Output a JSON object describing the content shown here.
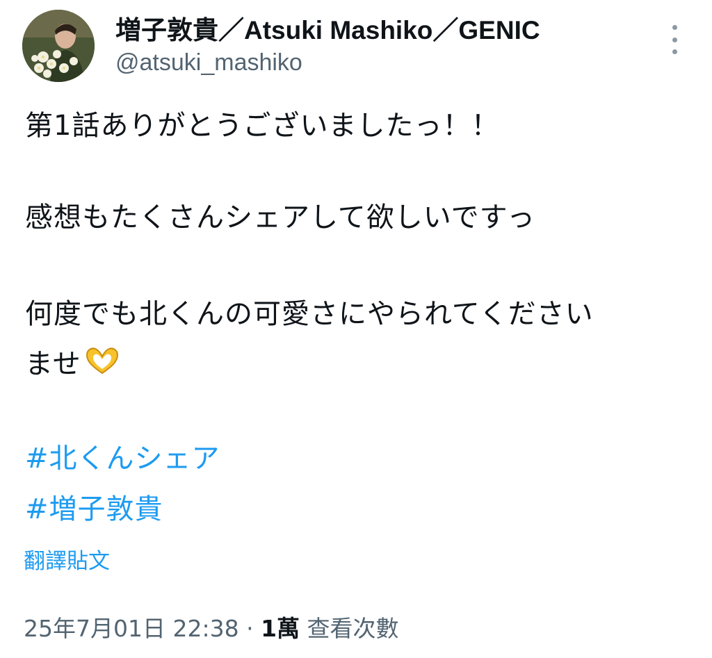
{
  "author": {
    "display_name": "増子敦貴／Atsuki Mashiko／GENIC",
    "handle": "@atsuki_mashiko",
    "avatar_icon": "profile-photo-with-flowers"
  },
  "more_icon": "more-vertical-icon",
  "tweet": {
    "line1": "第1話ありがとうございましたっ！！",
    "line2": "感想もたくさんシェアして欲しいですっ",
    "line3": "何度でも北くんの可愛さにやられてください",
    "line4": "ませ",
    "emoji": "heart-hands-emoji",
    "hashtags": [
      "#北くんシェア",
      "#増子敦貴"
    ]
  },
  "translate_label": "翻譯貼文",
  "meta": {
    "timestamp": "25年7月01日 22:38",
    "separator": " · ",
    "views_count": "1萬",
    "views_label": " 查看次數"
  },
  "colors": {
    "link": "#1d9bf0",
    "text": "#0f1419",
    "secondary": "#536471"
  }
}
